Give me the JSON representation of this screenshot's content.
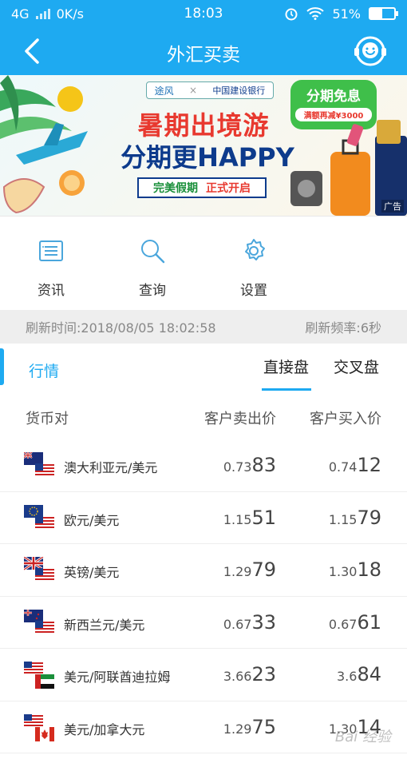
{
  "status_bar": {
    "network": "4G",
    "speed": "0K/s",
    "time": "18:03",
    "battery": "51%",
    "battery_level": 0.51
  },
  "nav": {
    "title": "外汇买卖"
  },
  "banner": {
    "partner_left": "途风",
    "partner_x": "×",
    "partner_right": "中国建设银行",
    "headline1": "暑期出境游",
    "headline2": "分期更HAPPY",
    "tag_green": "完美假期",
    "tag_red": "正式开启",
    "bubble_title": "分期免息",
    "bubble_sub": "满额再减¥3000",
    "ad_label": "广告"
  },
  "shortcuts": [
    {
      "label": "资讯",
      "icon": "news-list-icon"
    },
    {
      "label": "查询",
      "icon": "search-icon"
    },
    {
      "label": "设置",
      "icon": "gear-icon"
    }
  ],
  "refresh": {
    "time_text": "刷新时间:2018/08/05 18:02:58",
    "freq_text": "刷新频率:6秒"
  },
  "tabs": {
    "section": "行情",
    "direct": "直接盘",
    "cross": "交叉盘"
  },
  "columns": {
    "pair": "货币对",
    "sell": "客户卖出价",
    "buy": "客户买入价"
  },
  "rows": [
    {
      "pair": "澳大利亚元/美元",
      "sell_a": "0.73",
      "sell_b": "83",
      "buy_a": "0.74",
      "buy_b": "12"
    },
    {
      "pair": "欧元/美元",
      "sell_a": "1.15",
      "sell_b": "51",
      "buy_a": "1.15",
      "buy_b": "79"
    },
    {
      "pair": "英镑/美元",
      "sell_a": "1.29",
      "sell_b": "79",
      "buy_a": "1.30",
      "buy_b": "18"
    },
    {
      "pair": "新西兰元/美元",
      "sell_a": "0.67",
      "sell_b": "33",
      "buy_a": "0.67",
      "buy_b": "61"
    },
    {
      "pair": "美元/阿联酋迪拉姆",
      "sell_a": "3.66",
      "sell_b": "23",
      "buy_a": "3.6",
      "buy_b": "84"
    },
    {
      "pair": "美元/加拿大元",
      "sell_a": "1.29",
      "sell_b": "75",
      "buy_a": "1.30",
      "buy_b": "14"
    }
  ],
  "watermark": "Bai 经验"
}
